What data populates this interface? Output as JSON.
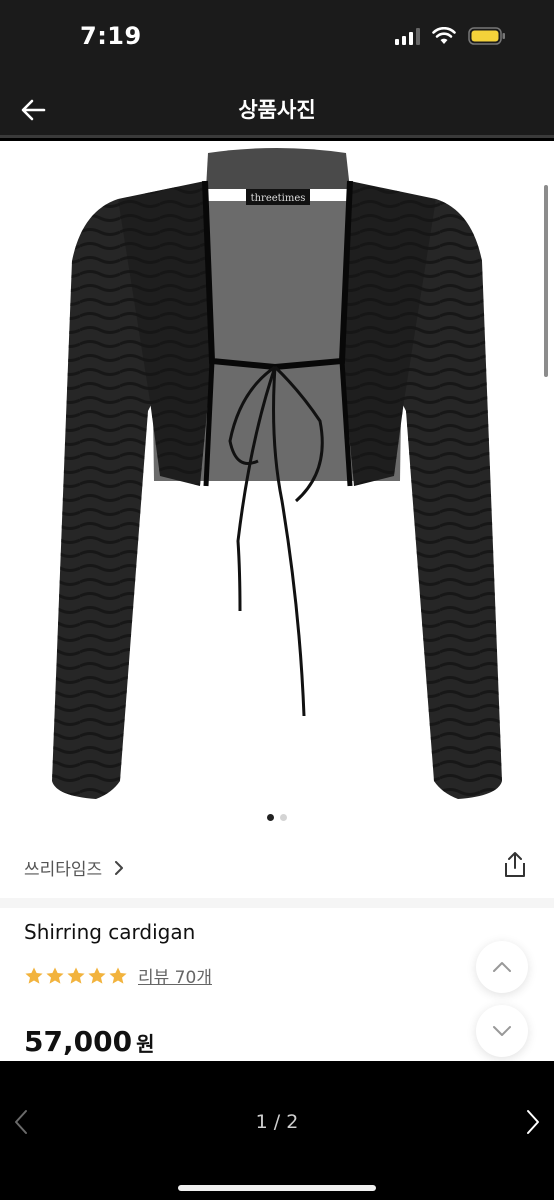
{
  "status_bar": {
    "time": "7:19"
  },
  "header": {
    "title": "상품사진"
  },
  "product_image": {
    "label_text": "threetimes",
    "slide_count": 2,
    "active_slide": 1
  },
  "brand": {
    "name": "쓰리타임즈"
  },
  "product": {
    "name": "Shirring cardigan",
    "rating": 5,
    "review_text": "리뷰 70개",
    "price": "57,000",
    "currency": "원"
  },
  "colors": {
    "star": "#f2b33d",
    "bar": "#1b1b1b"
  },
  "pager": {
    "indicator": "1 / 2"
  }
}
